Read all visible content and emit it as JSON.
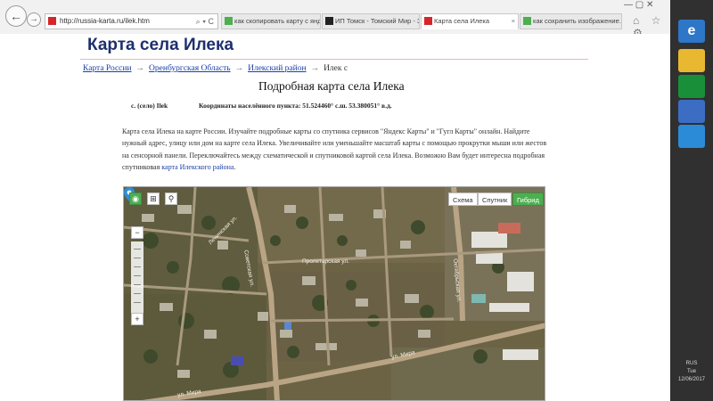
{
  "browser": {
    "url": "http://russia-karta.ru/ilek.htm",
    "address_tools": "⌕ ▾ C",
    "tabs": [
      {
        "label": "как скопировать карту с янде...",
        "active": false
      },
      {
        "label": "ИП Томск - Томский Мир - З...",
        "active": false
      },
      {
        "label": "Карта села Илека",
        "active": true
      },
      {
        "label": "как сохранить изображение...",
        "active": false
      }
    ],
    "window_controls": "—   ▢   ✕",
    "toolbar_icons": "⌂ ☆ ⚙"
  },
  "page": {
    "site_title": "Карта села Илека",
    "breadcrumb": {
      "item1": "Карта России",
      "item2": "Оренбургская Область",
      "item3": "Илекский район",
      "current": "Илек с",
      "separator": "→"
    },
    "heading": "Подробная карта села Илека",
    "settlement_label": "с. (село) Ilek",
    "coordinates": "Координаты населённого пункта: 51.524460° с.ш. 53.380051° в.д.",
    "description": "Карта села Илека на карте России. Изучайте подробные карты со спутника сервисов \"Яндекс Карты\" и \"Гугл Карты\" онлайн. Найдите нужный адрес, улицу или дом на карте села Илека. Увеличивайте или уменьшайте масштаб карты с помощью прокрутки мыши или жестов на сенсорной панели. Переключайтесь между схематической и спутниковой картой села Илека. Возможно Вам будет интересна подробная спутниковая",
    "description_link": "карта Илекского района",
    "description_end": "."
  },
  "map": {
    "mode_buttons": {
      "scheme": "Схема",
      "satellite": "Спутник",
      "hybrid": "Гибрид"
    },
    "zoom_in": "+",
    "zoom_out": "−",
    "streets": {
      "s1": "Пролетарская ул.",
      "s2": "Советская ул.",
      "s3": "ул. Мира",
      "s4": "ул. Мира",
      "s5": "Ленинская ул.",
      "s6": "Октябрьская ул."
    }
  },
  "system": {
    "lang": "RUS",
    "time": "Tue",
    "date": "12/06/2017"
  },
  "colors": {
    "title": "#1d2f6e",
    "link": "#1b3fa8",
    "hybrid_active": "#4caf50",
    "charm_bar": "#303030"
  }
}
